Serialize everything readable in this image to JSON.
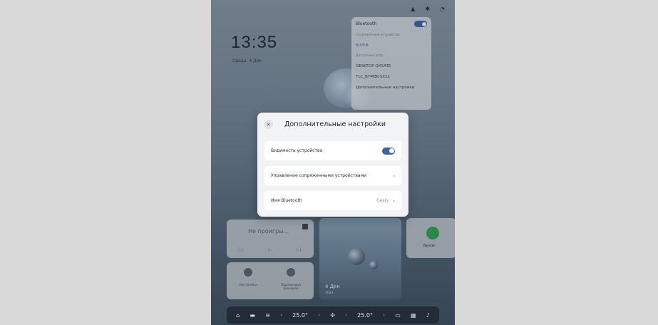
{
  "status_icons": [
    "signal-icon",
    "bluetooth-icon",
    "wifi-icon"
  ],
  "lockscreen": {
    "time": "13:35",
    "date": "Среда, 4 Дек"
  },
  "bt_panel": {
    "title": "Bluetooth",
    "paired_label": "Сопряжённые устройства",
    "paired_item": "BLUE-B",
    "available_label": "Доступные устр.",
    "devices": [
      "DESKTOP-QXSATE",
      "TLC_B7MBK-SX11"
    ],
    "more_link": "Дополнительные настройки"
  },
  "modal": {
    "title": "Дополнительные настройки",
    "close_glyph": "✕",
    "options": [
      {
        "label": "Видимость устройства",
        "type": "toggle",
        "on": true
      },
      {
        "label": "Управление сопряженными устройствами",
        "type": "chevron"
      },
      {
        "label": "Имя Bluetooth",
        "type": "value",
        "value": "Geely"
      }
    ],
    "chevron_glyph": "›"
  },
  "media": {
    "title": "Не проигры...",
    "prev": "|◁",
    "play": "▷",
    "next": "▷|"
  },
  "photo": {
    "date": "4 Дек",
    "year": "2024"
  },
  "call": {
    "label": "Вызов"
  },
  "quick": [
    {
      "label": "Настройки"
    },
    {
      "label": "Подзарядка фонарей"
    }
  ],
  "dock": {
    "left_temp": "25.0°",
    "right_temp": "25.0°",
    "arrow_left": "‹",
    "arrow_right": "›"
  },
  "colors": {
    "accent": "#3d62a6",
    "call_green": "#2fa84f",
    "modal_bg": "#f1f3f5"
  }
}
